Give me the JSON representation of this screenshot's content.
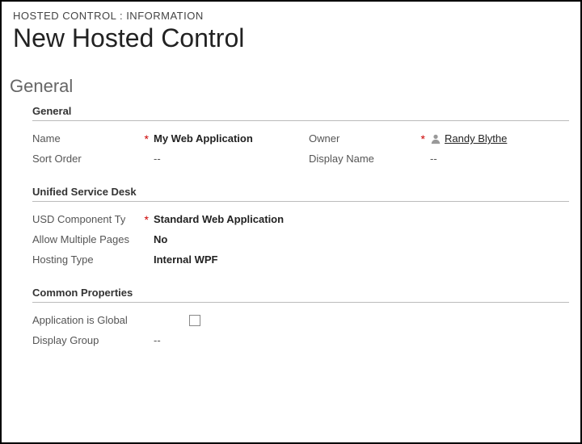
{
  "header": {
    "breadcrumb": "HOSTED CONTROL : INFORMATION",
    "title": "New Hosted Control"
  },
  "tab": "General",
  "sections": {
    "general": {
      "title": "General",
      "name_label": "Name",
      "name_value": "My Web Application",
      "sort_order_label": "Sort Order",
      "sort_order_value": "--",
      "owner_label": "Owner",
      "owner_value": "Randy Blythe",
      "display_name_label": "Display Name",
      "display_name_value": "--"
    },
    "usd": {
      "title": "Unified Service Desk",
      "component_type_label": "USD Component Ty",
      "component_type_value": "Standard Web Application",
      "allow_multiple_label": "Allow Multiple Pages",
      "allow_multiple_value": "No",
      "hosting_type_label": "Hosting Type",
      "hosting_type_value": "Internal WPF"
    },
    "common": {
      "title": "Common Properties",
      "app_global_label": "Application is Global",
      "display_group_label": "Display Group",
      "display_group_value": "--"
    }
  },
  "required_marker": "*"
}
